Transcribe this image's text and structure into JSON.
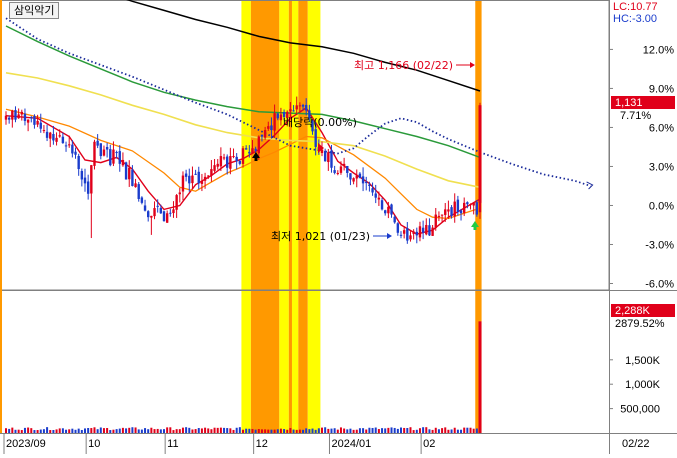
{
  "window": {
    "title": "삼익악기",
    "lc_label": "LC:10.77",
    "hc_label": "HC:-3.00"
  },
  "annotations": {
    "high_label": "최고 1,166 (02/22)",
    "low_label": "최저 1,021 (01/23)",
    "dividend_label": "배당락(0.00%)"
  },
  "colors": {
    "up": "#e0001a",
    "down": "#1a3ccc",
    "highlight_yellow": "#ffff00",
    "highlight_orange": "#ff9900",
    "ma_short": "#e0001a",
    "ma_orange": "#ff8800",
    "ma_yellow": "#f0e050",
    "ma_green": "#2a9a3a",
    "ma_black": "#000000",
    "ma_dotted": "#1a2a9a"
  },
  "chart_data": {
    "type": "candlestick",
    "title": "삼익악기",
    "price_panel": {
      "axis_labels": [
        "12.0%",
        "9.0%",
        "6.0%",
        "3.0%",
        "0.0%",
        "-3.0%",
        "-6.0%"
      ],
      "axis_values": [
        12,
        9,
        6,
        3,
        0,
        -3,
        -6
      ],
      "ylim": [
        -6.5,
        15.8
      ],
      "current_price_label": "1,131",
      "current_change_label": "7.71%",
      "high": {
        "value": 1166,
        "date": "02/22"
      },
      "low": {
        "value": 1021,
        "date": "01/23"
      }
    },
    "volume_panel": {
      "axis_labels": [
        "1,500K",
        "1,000K",
        "500,000"
      ],
      "axis_values": [
        1500000,
        1000000,
        500000
      ],
      "ylim": [
        0,
        2500000
      ],
      "current_volume_label": "2,288K",
      "current_volume_change_label": "2879.52%"
    },
    "x_axis": {
      "labels": [
        "2023/09",
        "10",
        "11",
        "12",
        "2024/01",
        "02",
        "02/22"
      ]
    },
    "highlight_bands": [
      {
        "color": "yellow",
        "from": 74.5,
        "to": 77.5
      },
      {
        "color": "orange",
        "from": 77.5,
        "to": 86.5
      },
      {
        "color": "yellow",
        "from": 86.5,
        "to": 89.5
      },
      {
        "color": "orange",
        "from": 89.5,
        "to": 90.5
      },
      {
        "color": "yellow",
        "from": 90.5,
        "to": 92.5
      },
      {
        "color": "orange",
        "from": 92.5,
        "to": 95.5
      },
      {
        "color": "yellow",
        "from": 95.5,
        "to": 99.5
      },
      {
        "color": "orange",
        "from": 148.5,
        "to": 150.5
      }
    ],
    "closes": [
      6.9,
      6.6,
      7.3,
      6.6,
      7.0,
      7.2,
      6.5,
      6.6,
      6.7,
      6.2,
      6.5,
      5.9,
      5.8,
      5.2,
      5.6,
      5.0,
      5.2,
      5.4,
      4.8,
      4.6,
      4.7,
      4.0,
      3.9,
      2.8,
      2.0,
      1.7,
      0.9,
      3.1,
      4.9,
      4.6,
      3.8,
      4.3,
      4.3,
      3.1,
      4.3,
      4.1,
      3.2,
      3.5,
      2.0,
      2.9,
      1.5,
      1.7,
      0.5,
      0.2,
      -0.4,
      -0.9,
      -0.8,
      -0.2,
      -0.1,
      -0.6,
      -1.2,
      -0.6,
      -0.6,
      -0.3,
      0.8,
      1.0,
      2.3,
      2.2,
      1.7,
      2.3,
      2.4,
      1.7,
      1.9,
      2.2,
      2.3,
      2.8,
      3.1,
      3.2,
      3.8,
      3.7,
      2.9,
      3.8,
      3.8,
      3.4,
      3.2,
      4.4,
      4.3,
      4.0,
      4.4,
      4.2,
      5.3,
      5.3,
      5.8,
      6.1,
      5.8,
      7.1,
      6.7,
      7.0,
      6.8,
      7.2,
      7.4,
      7.3,
      7.7,
      7.7,
      7.6,
      7.3,
      6.7,
      5.7,
      4.5,
      4.2,
      4.3,
      3.4,
      4.1,
      2.9,
      2.5,
      2.5,
      3.0,
      3.2,
      2.5,
      2.0,
      2.1,
      2.3,
      2.1,
      1.7,
      1.8,
      1.5,
      1.0,
      0.6,
      0.6,
      -0.3,
      -0.6,
      -0.1,
      -0.7,
      -1.3,
      -2.1,
      -2.3,
      -1.9,
      -2.7,
      -2.3,
      -2.0,
      -2.3,
      -1.6,
      -2.1,
      -1.5,
      -2.3,
      -1.7,
      -0.7,
      -0.8,
      -0.7,
      -0.3,
      -0.3,
      -0.8,
      0.3,
      -0.5,
      -0.6,
      0.2,
      0.1,
      0.1,
      0.2,
      -0.7,
      1.6
    ],
    "series": [
      {
        "name": "MA5",
        "points": [
          [
            0,
            6.9
          ],
          [
            10,
            6.7
          ],
          [
            20,
            5.3
          ],
          [
            25,
            3.5
          ],
          [
            30,
            3.3
          ],
          [
            35,
            3.7
          ],
          [
            40,
            2.8
          ],
          [
            45,
            1.1
          ],
          [
            50,
            -0.3
          ],
          [
            55,
            0.0
          ],
          [
            60,
            1.6
          ],
          [
            65,
            2.3
          ],
          [
            70,
            3.2
          ],
          [
            75,
            3.6
          ],
          [
            80,
            4.3
          ],
          [
            85,
            5.4
          ],
          [
            90,
            6.7
          ],
          [
            95,
            7.5
          ],
          [
            100,
            5.6
          ],
          [
            105,
            3.4
          ],
          [
            110,
            2.5
          ],
          [
            115,
            1.7
          ],
          [
            120,
            0.4
          ],
          [
            125,
            -1.5
          ],
          [
            130,
            -2.2
          ],
          [
            135,
            -1.9
          ],
          [
            140,
            -0.9
          ],
          [
            145,
            -0.2
          ],
          [
            150,
            0.5
          ]
        ]
      },
      {
        "name": "MA20",
        "points": [
          [
            0,
            7.4
          ],
          [
            10,
            6.8
          ],
          [
            20,
            6.1
          ],
          [
            30,
            5.0
          ],
          [
            40,
            4.2
          ],
          [
            50,
            2.5
          ],
          [
            55,
            1.4
          ],
          [
            60,
            1.1
          ],
          [
            65,
            1.8
          ],
          [
            70,
            2.5
          ],
          [
            75,
            3.0
          ],
          [
            80,
            3.6
          ],
          [
            85,
            4.1
          ],
          [
            90,
            4.7
          ],
          [
            95,
            5.3
          ],
          [
            100,
            5.2
          ],
          [
            110,
            3.9
          ],
          [
            120,
            2.1
          ],
          [
            125,
            0.9
          ],
          [
            130,
            -0.3
          ],
          [
            135,
            -0.9
          ],
          [
            140,
            -1.0
          ],
          [
            145,
            -0.6
          ],
          [
            150,
            -0.2
          ]
        ]
      },
      {
        "name": "MA60",
        "points": [
          [
            0,
            10.2
          ],
          [
            10,
            9.8
          ],
          [
            20,
            9.2
          ],
          [
            30,
            8.5
          ],
          [
            40,
            7.7
          ],
          [
            50,
            7.0
          ],
          [
            60,
            6.2
          ],
          [
            70,
            5.6
          ],
          [
            80,
            5.2
          ],
          [
            90,
            5.0
          ],
          [
            100,
            4.9
          ],
          [
            110,
            4.6
          ],
          [
            120,
            3.8
          ],
          [
            130,
            2.8
          ],
          [
            140,
            1.9
          ],
          [
            150,
            1.4
          ]
        ]
      },
      {
        "name": "MA120",
        "points": [
          [
            0,
            13.8
          ],
          [
            10,
            12.6
          ],
          [
            20,
            11.5
          ],
          [
            30,
            10.5
          ],
          [
            40,
            9.5
          ],
          [
            50,
            8.7
          ],
          [
            60,
            8.1
          ],
          [
            70,
            7.6
          ],
          [
            80,
            7.2
          ],
          [
            90,
            7.1
          ],
          [
            100,
            7.0
          ],
          [
            110,
            6.5
          ],
          [
            120,
            5.9
          ],
          [
            130,
            5.3
          ],
          [
            140,
            4.6
          ],
          [
            150,
            3.7
          ]
        ]
      },
      {
        "name": "MA240",
        "points": [
          [
            0,
            18.5
          ],
          [
            10,
            17.9
          ],
          [
            20,
            17.2
          ],
          [
            30,
            16.5
          ],
          [
            40,
            15.7
          ],
          [
            50,
            15.0
          ],
          [
            60,
            14.3
          ],
          [
            70,
            13.7
          ],
          [
            80,
            13.0
          ],
          [
            90,
            12.5
          ],
          [
            100,
            12.2
          ],
          [
            110,
            11.7
          ],
          [
            120,
            11.0
          ],
          [
            130,
            10.4
          ],
          [
            140,
            9.6
          ],
          [
            150,
            8.8
          ]
        ]
      },
      {
        "name": "MA-shifted",
        "points": [
          [
            0,
            14.4
          ],
          [
            10,
            12.8
          ],
          [
            20,
            11.7
          ],
          [
            30,
            10.8
          ],
          [
            40,
            9.9
          ],
          [
            50,
            8.9
          ],
          [
            60,
            7.9
          ],
          [
            70,
            7.0
          ],
          [
            80,
            5.8
          ],
          [
            90,
            4.6
          ],
          [
            100,
            4.2
          ],
          [
            105,
            4.0
          ],
          [
            110,
            4.4
          ],
          [
            115,
            5.4
          ],
          [
            120,
            6.3
          ],
          [
            125,
            6.7
          ],
          [
            130,
            6.4
          ],
          [
            135,
            5.7
          ],
          [
            140,
            5.1
          ],
          [
            145,
            4.6
          ],
          [
            150,
            4.1
          ],
          [
            160,
            3.2
          ],
          [
            170,
            2.4
          ],
          [
            180,
            1.9
          ],
          [
            185,
            1.5
          ]
        ]
      }
    ],
    "volume_x": 150,
    "volume_value": 2288000
  }
}
